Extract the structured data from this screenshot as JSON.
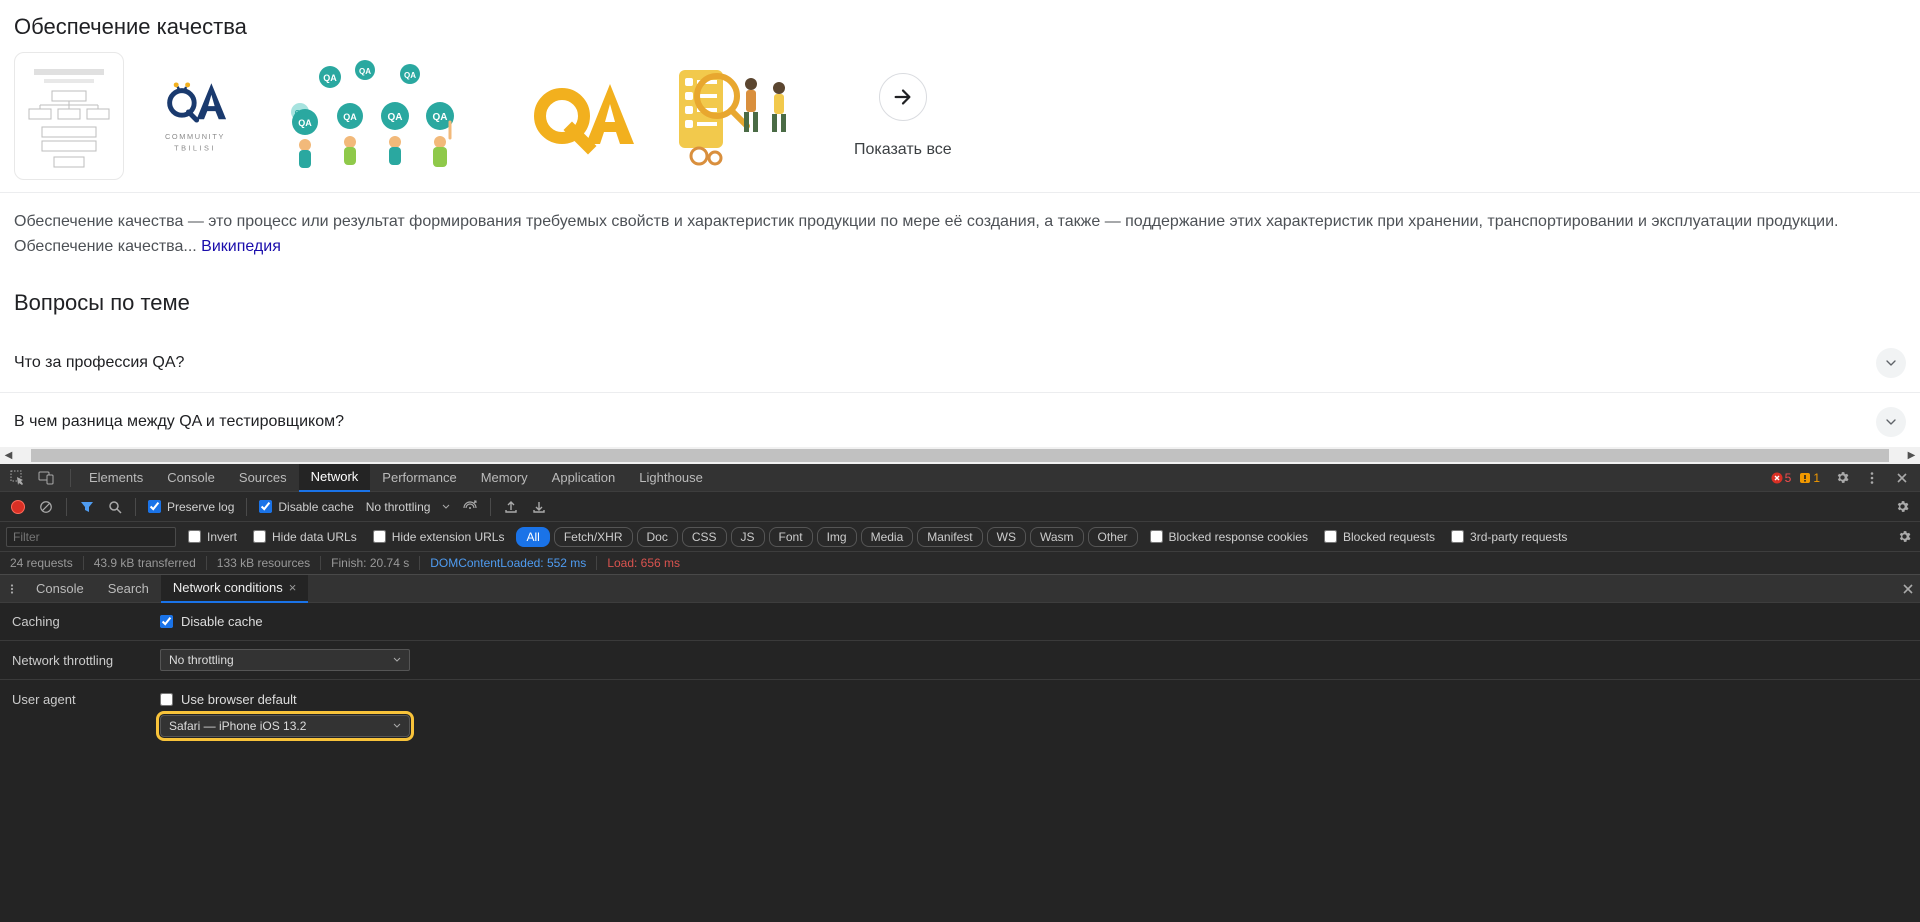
{
  "search": {
    "heading": "Обеспечение качества",
    "show_all": "Показать все",
    "snippet_p1": "Обеспечение качества — это процесс или результат формирования требуемых свойств и характеристик продукции по мере её создания, а также — поддержание этих характеристик при хранении, транспортировании и эксплуатации продукции.",
    "snippet_p2_prefix": "Обеспечение качества... ",
    "snippet_link": "Википедия",
    "questions_heading": "Вопросы по теме",
    "questions": [
      "Что за профессия QA?",
      "В чем разница между QA и тестировщиком?"
    ],
    "thumb_qa_community_top": "COMMUNITY",
    "thumb_qa_community_bottom": "TBILISI"
  },
  "devtools": {
    "tabs": [
      "Elements",
      "Console",
      "Sources",
      "Network",
      "Performance",
      "Memory",
      "Application",
      "Lighthouse"
    ],
    "active_tab": "Network",
    "errors": "5",
    "issues": "1",
    "preserve_log": "Preserve log",
    "disable_cache": "Disable cache",
    "throttling": "No throttling",
    "filter_placeholder": "Filter",
    "invert": "Invert",
    "hide_data_urls": "Hide data URLs",
    "hide_ext_urls": "Hide extension URLs",
    "pills": [
      "All",
      "Fetch/XHR",
      "Doc",
      "CSS",
      "JS",
      "Font",
      "Img",
      "Media",
      "Manifest",
      "WS",
      "Wasm",
      "Other"
    ],
    "blocked_cookies": "Blocked response cookies",
    "blocked_requests": "Blocked requests",
    "third_party": "3rd-party requests",
    "status": {
      "requests": "24 requests",
      "transferred": "43.9 kB transferred",
      "resources": "133 kB resources",
      "finish": "Finish: 20.74 s",
      "dcl": "DOMContentLoaded: 552 ms",
      "load": "Load: 656 ms"
    },
    "drawer_tabs": [
      "Console",
      "Search",
      "Network conditions"
    ],
    "drawer_active": "Network conditions",
    "nc": {
      "caching_label": "Caching",
      "caching_check": "Disable cache",
      "throttle_label": "Network throttling",
      "throttle_value": "No throttling",
      "ua_label": "User agent",
      "ua_default": "Use browser default",
      "ua_value": "Safari — iPhone iOS 13.2"
    }
  }
}
